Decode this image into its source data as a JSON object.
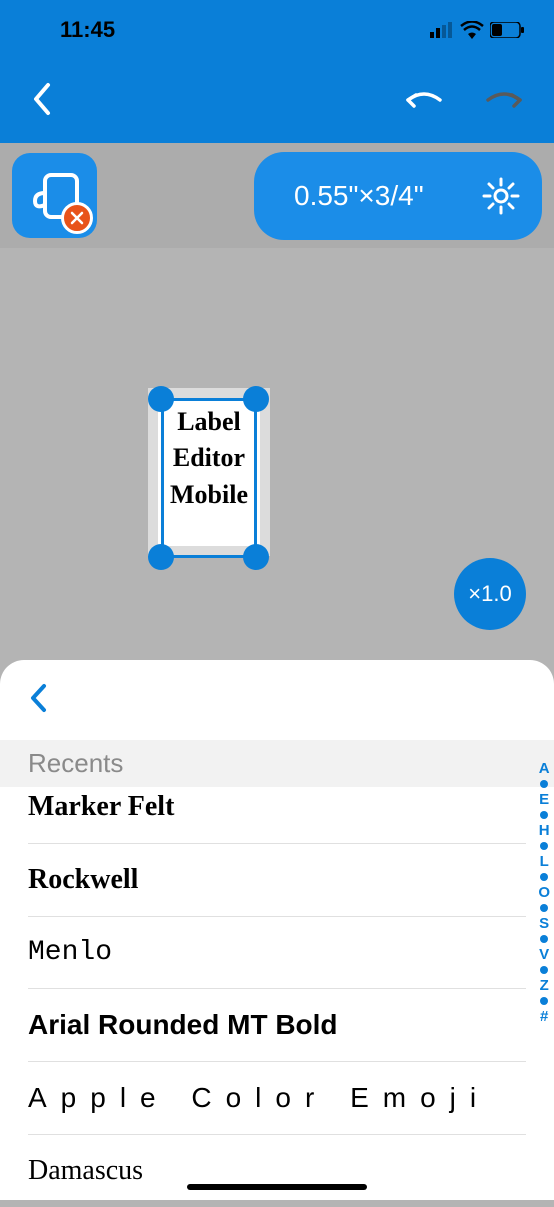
{
  "statusBar": {
    "time": "11:45"
  },
  "toolbar": {
    "sizeLabel": "0.55\"×3/4\""
  },
  "canvas": {
    "labelText": "Label Editor Mobile",
    "zoom": "×1.0"
  },
  "sheet": {
    "sectionTitle": "Recents",
    "fonts": [
      "Marker Felt",
      "Rockwell",
      "Menlo",
      "Arial Rounded MT Bold",
      "Apple Color Emoji",
      "Damascus"
    ],
    "index": [
      "A",
      "E",
      "H",
      "L",
      "O",
      "S",
      "V",
      "Z",
      "#"
    ]
  }
}
